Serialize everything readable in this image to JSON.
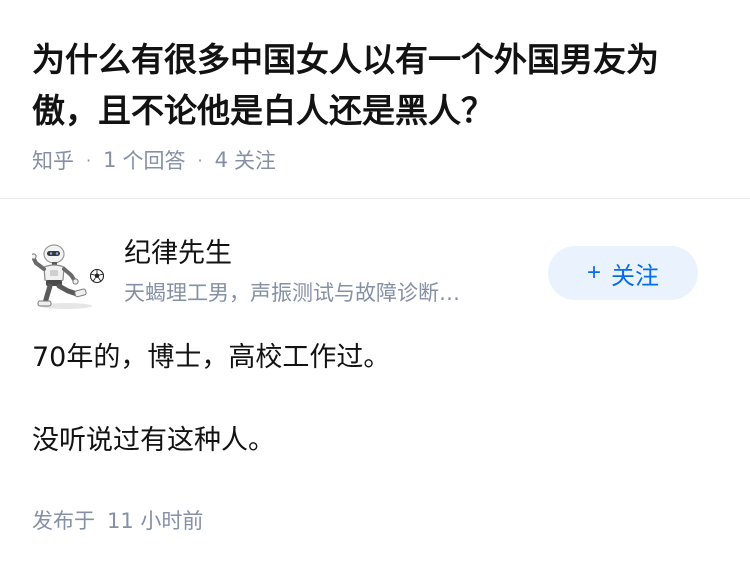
{
  "question": {
    "title": "为什么有很多中国女人以有一个外国男友为傲，且不论他是白人还是黑人？",
    "source": "知乎",
    "answer_count": "1",
    "answer_label": "个回答",
    "follower_count": "4",
    "follower_label": "关注"
  },
  "author": {
    "name": "纪律先生",
    "headline": "天蝎理工男，声振测试与故障诊断…",
    "avatar_icon": "robot-soccer-avatar-icon",
    "follow_label": "关注",
    "follow_icon": "plus-icon"
  },
  "answer": {
    "paragraphs": [
      "70年的，博士，高校工作过。",
      "没听说过有这种人。"
    ],
    "published_prefix": "发布于",
    "published_time": "11 小时前"
  },
  "colors": {
    "text": "#121212",
    "muted": "#8590a6",
    "accent": "#056de8",
    "follow_bg": "#eaf3fd",
    "divider": "#ebebeb"
  }
}
